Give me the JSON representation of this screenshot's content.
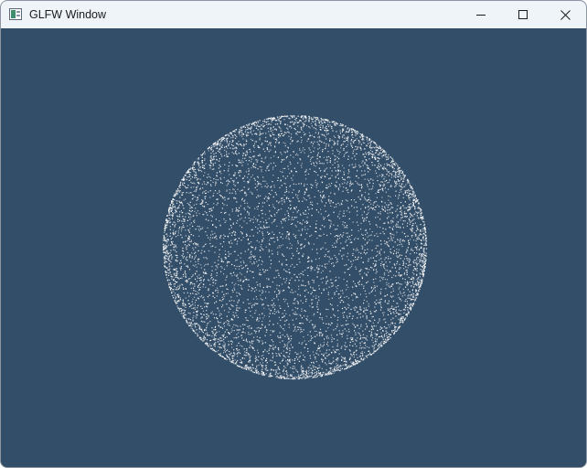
{
  "window": {
    "title": "GLFW Window",
    "app_icon": "glfw-app-icon",
    "controls": [
      {
        "name": "minimize",
        "icon": "minimize-icon"
      },
      {
        "name": "maximize",
        "icon": "maximize-icon"
      },
      {
        "name": "close",
        "icon": "close-icon"
      }
    ]
  },
  "scene": {
    "background_color": "#334e68",
    "point_color": "#ffffff",
    "description_shape": "sphere-point-cloud"
  }
}
